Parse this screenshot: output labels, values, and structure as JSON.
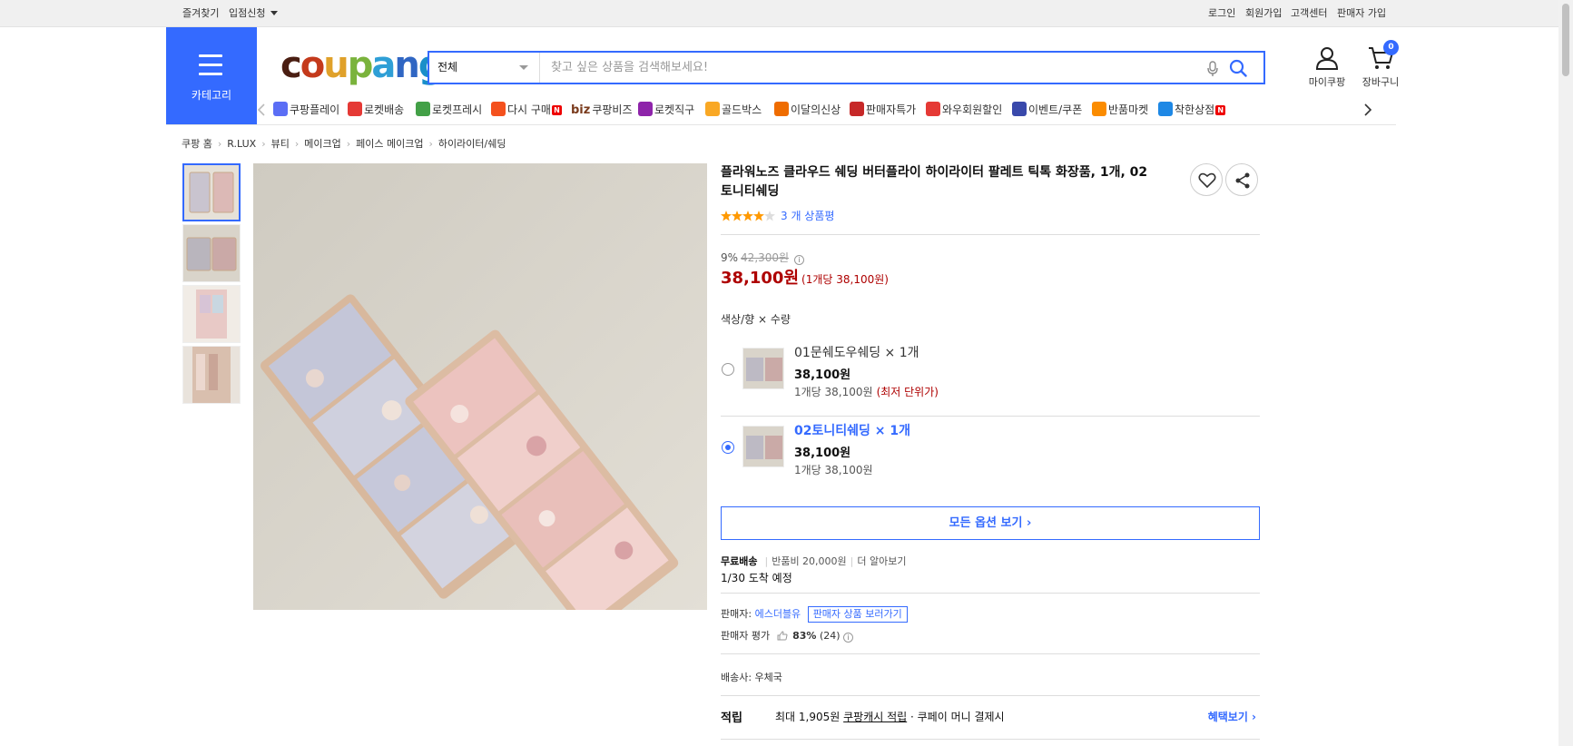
{
  "topbar": {
    "left": [
      "즐겨찾기",
      "입점신청"
    ],
    "right": [
      "로그인",
      "회원가입",
      "고객센터",
      "판매자 가입"
    ]
  },
  "header": {
    "category_label": "카테고리",
    "logo_letters": [
      "c",
      "o",
      "u",
      "p",
      "a",
      "n",
      "g"
    ],
    "logo_colors": [
      "#4a1e12",
      "#c43a1c",
      "#e0a12a",
      "#7ab33c",
      "#2f9fd6",
      "#3066c3",
      "#1a8fc9"
    ],
    "search_category": "전체",
    "search_placeholder": "찾고 싶은 상품을 검색해보세요!",
    "mycoupang": "마이쿠팡",
    "cart": "장바구니",
    "cart_count": "0",
    "accent": "#346aff"
  },
  "nav": {
    "items": [
      {
        "label": "쿠팡플레이",
        "icon": "play-icon"
      },
      {
        "label": "로켓배송",
        "icon": "rocket-icon"
      },
      {
        "label": "로켓프레시",
        "icon": "rocket-fresh-icon"
      },
      {
        "label": "다시 구매",
        "icon": "basket-icon",
        "badge": "N"
      },
      {
        "label": "쿠팡비즈",
        "prefix": "biz",
        "icon": ""
      },
      {
        "label": "로켓직구",
        "icon": "global-icon"
      },
      {
        "label": "골드박스",
        "icon": "giftbox-icon"
      },
      {
        "label": "이달의신상",
        "icon": "new-bag-icon"
      },
      {
        "label": "판매자특가",
        "icon": "percent-icon"
      },
      {
        "label": "와우회원할인",
        "icon": "wow-icon"
      },
      {
        "label": "이벤트/쿠폰",
        "icon": "coupon-icon"
      },
      {
        "label": "반품마켓",
        "icon": "market-icon"
      },
      {
        "label": "착한상점",
        "icon": "store-icon",
        "badge": "N"
      }
    ],
    "badge_text": "N"
  },
  "breadcrumb": [
    "쿠팡 홈",
    "R.LUX",
    "뷰티",
    "메이크업",
    "페이스 메이크업",
    "하이라이터/쉐딩"
  ],
  "product": {
    "title": "플라워노즈 클라우드 쉐딩 버터플라이 하이라이터 팔레트 틱톡 화장품, 1개, 02토니티쉐딩",
    "rating": 4.5,
    "review_count": "3 개 상품평",
    "discount": "9%",
    "original_price": "42,300원",
    "price": "38,100원",
    "unit_price": "(1개당 38,100원)",
    "option_label": "색상/향 × 수량",
    "options": [
      {
        "name": "01문쉐도우쉐딩 × 1개",
        "price": "38,100원",
        "unit": "1개당 38,100원",
        "best": "(최저 단위가)",
        "selected": false
      },
      {
        "name": "02토니티쉐딩 × 1개",
        "price": "38,100원",
        "unit": "1개당 38,100원",
        "best": "",
        "selected": true
      }
    ],
    "all_options": "모든 옵션 보기",
    "shipping": {
      "free": "무료배송",
      "return_fee": "반품비 20,000원",
      "more": "더 알아보기",
      "arrival": "1/30 도착 예정"
    },
    "seller": {
      "label": "판매자:",
      "name": "에스더블유",
      "button": "판매자 상품 보러가기",
      "rating_label": "판매자 평가",
      "rating_value": "83%",
      "rating_count": "(24)"
    },
    "carrier": "배송사: 우체국",
    "reward": {
      "label": "적립",
      "prefix": "최대 1,905원",
      "cash": "쿠팡캐시 적립",
      "suffix": "· 쿠페이 머니 결제시",
      "benefit": "혜택보기"
    }
  },
  "thumbnails": [
    "thumb-1",
    "thumb-2",
    "thumb-3",
    "thumb-4"
  ]
}
